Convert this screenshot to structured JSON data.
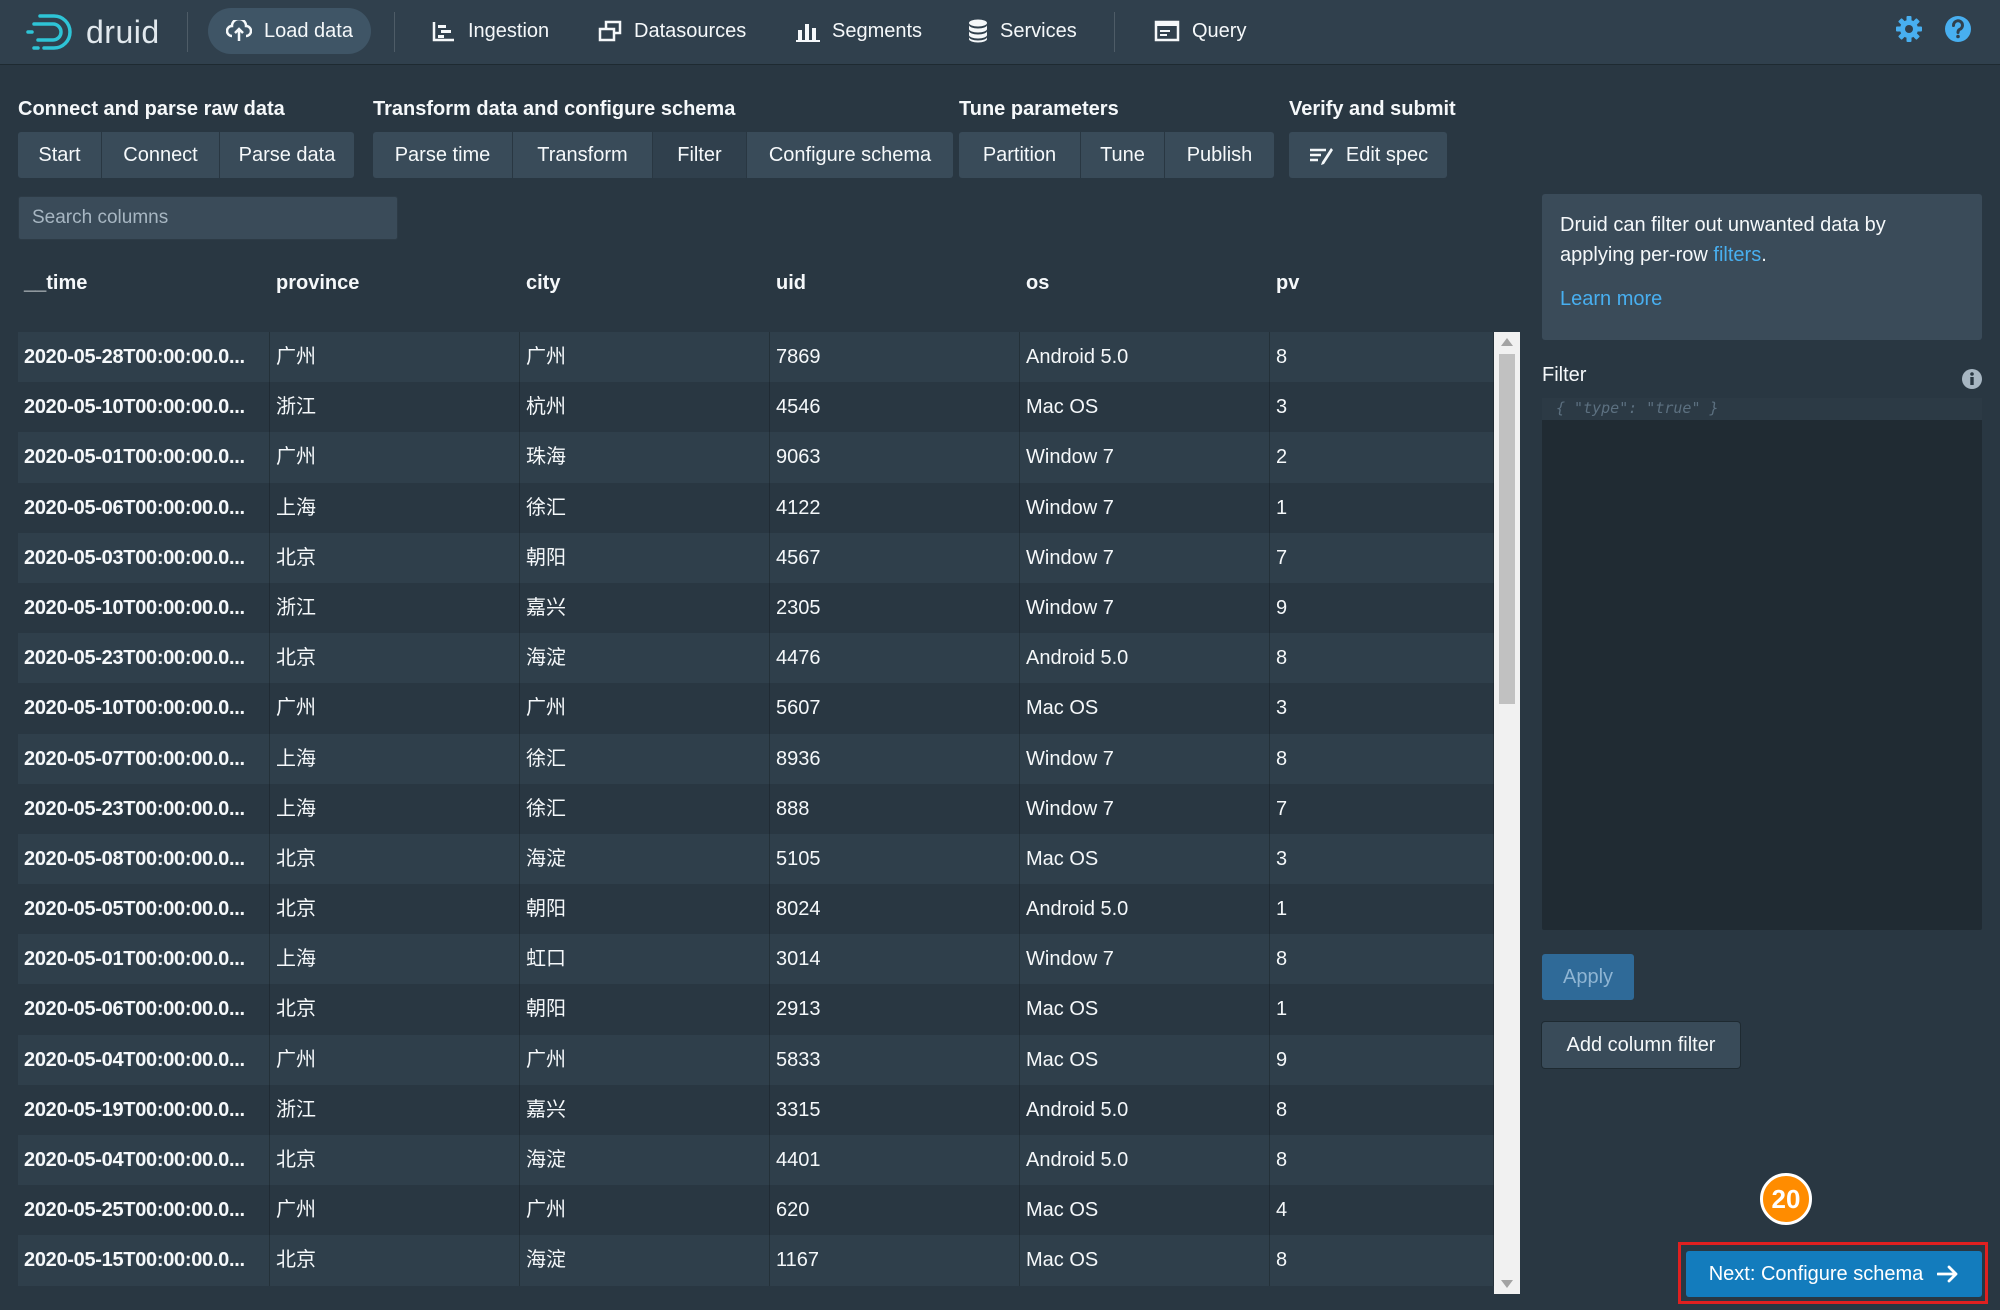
{
  "app": {
    "name": "druid"
  },
  "nav": {
    "load_data": "Load data",
    "ingestion": "Ingestion",
    "datasources": "Datasources",
    "segments": "Segments",
    "services": "Services",
    "query": "Query"
  },
  "steps": {
    "group1": {
      "title": "Connect and parse raw data",
      "items": [
        "Start",
        "Connect",
        "Parse data"
      ]
    },
    "group2": {
      "title": "Transform data and configure schema",
      "items": [
        "Parse time",
        "Transform",
        "Filter",
        "Configure schema"
      ]
    },
    "group3": {
      "title": "Tune parameters",
      "items": [
        "Partition",
        "Tune",
        "Publish"
      ]
    },
    "group4": {
      "title": "Verify and submit",
      "items": [
        "Edit spec"
      ]
    },
    "current": "Filter"
  },
  "search": {
    "placeholder": "Search columns"
  },
  "table": {
    "columns": [
      "__time",
      "province",
      "city",
      "uid",
      "os",
      "pv"
    ],
    "rows": [
      [
        "2020-05-28T00:00:00.0...",
        "广州",
        "广州",
        "7869",
        "Android 5.0",
        "8"
      ],
      [
        "2020-05-10T00:00:00.0...",
        "浙江",
        "杭州",
        "4546",
        "Mac OS",
        "3"
      ],
      [
        "2020-05-01T00:00:00.0...",
        "广州",
        "珠海",
        "9063",
        "Window 7",
        "2"
      ],
      [
        "2020-05-06T00:00:00.0...",
        "上海",
        "徐汇",
        "4122",
        "Window 7",
        "1"
      ],
      [
        "2020-05-03T00:00:00.0...",
        "北京",
        "朝阳",
        "4567",
        "Window 7",
        "7"
      ],
      [
        "2020-05-10T00:00:00.0...",
        "浙江",
        "嘉兴",
        "2305",
        "Window 7",
        "9"
      ],
      [
        "2020-05-23T00:00:00.0...",
        "北京",
        "海淀",
        "4476",
        "Android 5.0",
        "8"
      ],
      [
        "2020-05-10T00:00:00.0...",
        "广州",
        "广州",
        "5607",
        "Mac OS",
        "3"
      ],
      [
        "2020-05-07T00:00:00.0...",
        "上海",
        "徐汇",
        "8936",
        "Window 7",
        "8"
      ],
      [
        "2020-05-23T00:00:00.0...",
        "上海",
        "徐汇",
        "888",
        "Window 7",
        "7"
      ],
      [
        "2020-05-08T00:00:00.0...",
        "北京",
        "海淀",
        "5105",
        "Mac OS",
        "3"
      ],
      [
        "2020-05-05T00:00:00.0...",
        "北京",
        "朝阳",
        "8024",
        "Android 5.0",
        "1"
      ],
      [
        "2020-05-01T00:00:00.0...",
        "上海",
        "虹口",
        "3014",
        "Window 7",
        "8"
      ],
      [
        "2020-05-06T00:00:00.0...",
        "北京",
        "朝阳",
        "2913",
        "Mac OS",
        "1"
      ],
      [
        "2020-05-04T00:00:00.0...",
        "广州",
        "广州",
        "5833",
        "Mac OS",
        "9"
      ],
      [
        "2020-05-19T00:00:00.0...",
        "浙江",
        "嘉兴",
        "3315",
        "Android 5.0",
        "8"
      ],
      [
        "2020-05-04T00:00:00.0...",
        "北京",
        "海淀",
        "4401",
        "Android 5.0",
        "8"
      ],
      [
        "2020-05-25T00:00:00.0...",
        "广州",
        "广州",
        "620",
        "Mac OS",
        "4"
      ],
      [
        "2020-05-15T00:00:00.0...",
        "北京",
        "海淀",
        "1167",
        "Mac OS",
        "8"
      ]
    ]
  },
  "panel": {
    "callout_text": "Druid can filter out unwanted data by applying per-row ",
    "callout_link": "filters",
    "callout_end": ".",
    "learn_more": "Learn more",
    "filter_label": "Filter",
    "filter_placeholder": "{ \"type\": \"true\" }",
    "apply": "Apply",
    "add_column_filter": "Add column filter",
    "next": "Next: Configure schema"
  },
  "annotation": {
    "badge": "20"
  },
  "colors": {
    "accent": "#137cbd",
    "link": "#48aff0",
    "badge": "#ff8c00",
    "highlight": "#e02020"
  }
}
